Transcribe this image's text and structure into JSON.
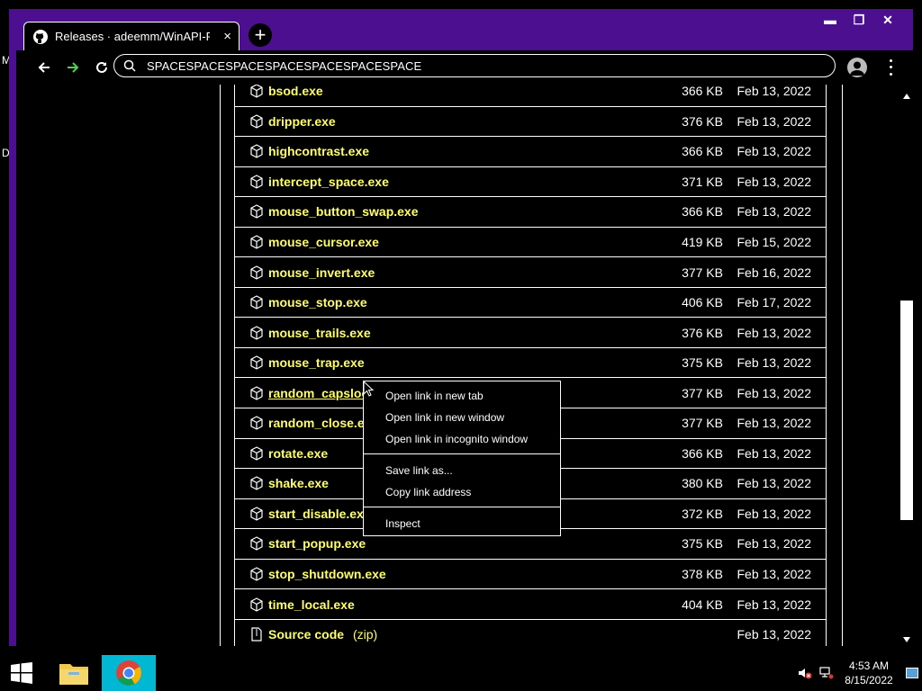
{
  "desktop": {
    "letters": [
      "M",
      "D"
    ]
  },
  "window": {
    "controls": {
      "minimize": "▬",
      "maximize": "❐",
      "close": "✕"
    }
  },
  "tab": {
    "title": "Releases · adeemm/WinAPI-Fun",
    "close": "×",
    "icon": "github-icon"
  },
  "new_tab_label": "+",
  "toolbar": {
    "back_icon": "arrow-left-icon",
    "forward_icon": "arrow-right-icon",
    "reload_icon": "reload-icon",
    "url": "SPACESPACESPACESPACESPACESPACESPACE",
    "profile_icon": "avatar-icon",
    "menu_icon": "three-dots-icon"
  },
  "assets": [
    {
      "name": "bsod.exe",
      "size": "366 KB",
      "date": "Feb 13, 2022"
    },
    {
      "name": "dripper.exe",
      "size": "376 KB",
      "date": "Feb 13, 2022"
    },
    {
      "name": "highcontrast.exe",
      "size": "366 KB",
      "date": "Feb 13, 2022"
    },
    {
      "name": "intercept_space.exe",
      "size": "371 KB",
      "date": "Feb 13, 2022"
    },
    {
      "name": "mouse_button_swap.exe",
      "size": "366 KB",
      "date": "Feb 13, 2022"
    },
    {
      "name": "mouse_cursor.exe",
      "size": "419 KB",
      "date": "Feb 15, 2022"
    },
    {
      "name": "mouse_invert.exe",
      "size": "377 KB",
      "date": "Feb 16, 2022"
    },
    {
      "name": "mouse_stop.exe",
      "size": "406 KB",
      "date": "Feb 17, 2022"
    },
    {
      "name": "mouse_trails.exe",
      "size": "376 KB",
      "date": "Feb 13, 2022"
    },
    {
      "name": "mouse_trap.exe",
      "size": "375 KB",
      "date": "Feb 13, 2022"
    },
    {
      "name": "random_capslock.exe",
      "size": "377 KB",
      "date": "Feb 13, 2022"
    },
    {
      "name": "random_close.exe",
      "size": "377 KB",
      "date": "Feb 13, 2022"
    },
    {
      "name": "rotate.exe",
      "size": "366 KB",
      "date": "Feb 13, 2022"
    },
    {
      "name": "shake.exe",
      "size": "380 KB",
      "date": "Feb 13, 2022"
    },
    {
      "name": "start_disable.exe",
      "size": "372 KB",
      "date": "Feb 13, 2022"
    },
    {
      "name": "start_popup.exe",
      "size": "375 KB",
      "date": "Feb 13, 2022"
    },
    {
      "name": "stop_shutdown.exe",
      "size": "378 KB",
      "date": "Feb 13, 2022"
    },
    {
      "name": "time_local.exe",
      "size": "404 KB",
      "date": "Feb 13, 2022"
    },
    {
      "name": "Source code",
      "sub": "(zip)",
      "size": "",
      "date": "Feb 13, 2022"
    }
  ],
  "context_menu": {
    "items": [
      "Open link in new tab",
      "Open link in new window",
      "Open link in incognito window",
      "Save link as...",
      "Copy link address",
      "Inspect"
    ]
  },
  "taskbar": {
    "start_icon": "windows-logo-icon",
    "apps": [
      "file-explorer-icon",
      "chrome-icon"
    ],
    "time": "4:53 AM",
    "date": "8/15/2022",
    "tray_icons": [
      "volume-muted-icon",
      "network-icon",
      "action-center-icon"
    ]
  },
  "colors": {
    "window_frame": "#4b0f8f",
    "link_text": "#ffff6b",
    "taskbar_active": "#00b7d4",
    "forward_arrow": "#4fd24f"
  }
}
